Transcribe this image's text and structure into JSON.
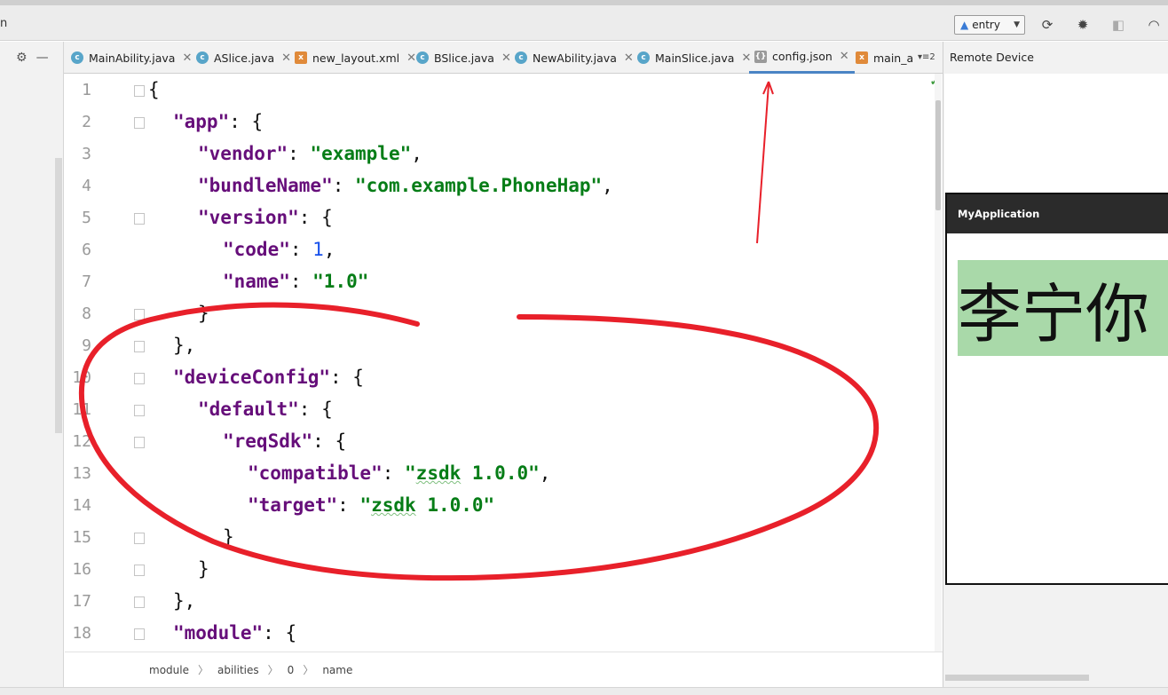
{
  "toolbar": {
    "cut_label": "n",
    "run_config": "entry",
    "icons": [
      "refresh-icon",
      "debug-bug-icon",
      "attach-icon",
      "profiler-icon"
    ]
  },
  "tabs": [
    {
      "label": "MainAbility.java",
      "type": "java"
    },
    {
      "label": "ASlice.java",
      "type": "java"
    },
    {
      "label": "new_layout.xml",
      "type": "xml"
    },
    {
      "label": "BSlice.java",
      "type": "java"
    },
    {
      "label": "NewAbility.java",
      "type": "java"
    },
    {
      "label": "MainSlice.java",
      "type": "java"
    },
    {
      "label": "config.json",
      "type": "json",
      "active": true
    },
    {
      "label": "main_a",
      "type": "xml"
    }
  ],
  "tab_overflow": "▾≡2",
  "editor": {
    "line_numbers": [
      "1",
      "2",
      "3",
      "4",
      "5",
      "6",
      "7",
      "8",
      "9",
      "10",
      "11",
      "12",
      "13",
      "14",
      "15",
      "16",
      "17",
      "18"
    ]
  },
  "breadcrumb": [
    "module",
    "abilities",
    "0",
    "name"
  ],
  "right_panel": {
    "title": "Remote Device",
    "device": {
      "app_title": "MyApplication",
      "text": "李宁你"
    }
  },
  "colors": {
    "keyword": "#660e7a",
    "string": "#067d17",
    "number": "#1750eb",
    "annotation": "#e8202a",
    "active_tab": "#4a84c4"
  }
}
